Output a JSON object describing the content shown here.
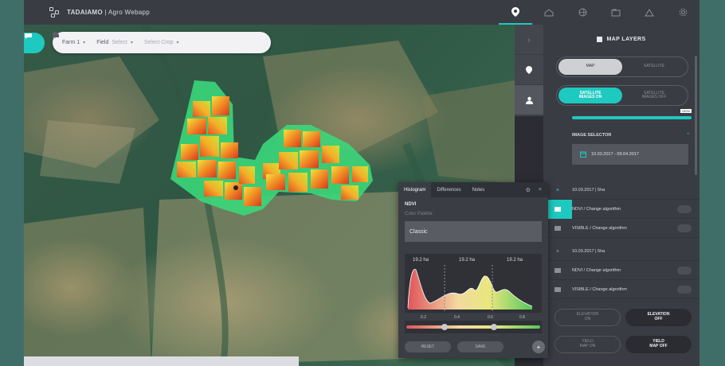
{
  "app": {
    "brand_bold": "TADAIAMO",
    "brand_rest": " | Agro Webapp"
  },
  "topbar": {
    "icons": [
      "map-pin-icon",
      "farm-icon",
      "globe-icon",
      "folder-icon",
      "alert-icon",
      "settings-icon"
    ]
  },
  "breadcrumb": {
    "farm": "Farm 1",
    "field_label": "Field",
    "field_value": "Select",
    "crop_placeholder": "Select Crop"
  },
  "map_layers": {
    "title": "MAP LAYERS",
    "toggle1": {
      "left": "MAP",
      "right": "SATELLITE"
    },
    "toggle2": {
      "left": "SATELLITE\nIMAGES ON",
      "right": "SATELLITE\nIMAGES OFF"
    },
    "opacity": {
      "value_label": "100%",
      "fraction": 1.0
    }
  },
  "image_selector": {
    "title": "IMAGE SELECTOR",
    "date_range": "10.03.2017 - 09.04.2017"
  },
  "entries": [
    {
      "date": "10.03.2017 | 5ha",
      "rows": [
        "NDVI / Change algorithm",
        "VISIBLE / Change algorithm"
      ]
    },
    {
      "date": "10.03.2017 | 5ha",
      "rows": [
        "NDVI / Change algorithm",
        "VISIBLE / Change algorithm"
      ]
    }
  ],
  "buttons": {
    "row1": [
      "ELEVATION\nON",
      "ELEVATION\nOFF"
    ],
    "row2": [
      "YIELD\nMAP ON",
      "YIELD\nMAP OFF"
    ]
  },
  "histogram": {
    "tabs": [
      "Histogram",
      "Differences",
      "Notes"
    ],
    "index": "NDVI",
    "sublabel": "Color Palette",
    "palette": "Classic",
    "area_labels": [
      "19.2 ha",
      "19.2 ha",
      "19.2 ha"
    ],
    "ticks": [
      "0.2",
      "0.4",
      "0.6",
      "0.8"
    ],
    "buttons": [
      "RESET",
      "SAVE"
    ]
  },
  "colors": {
    "accent": "#1ec9c0",
    "panel": "#3a3c44",
    "dark": "#2b2d33"
  }
}
